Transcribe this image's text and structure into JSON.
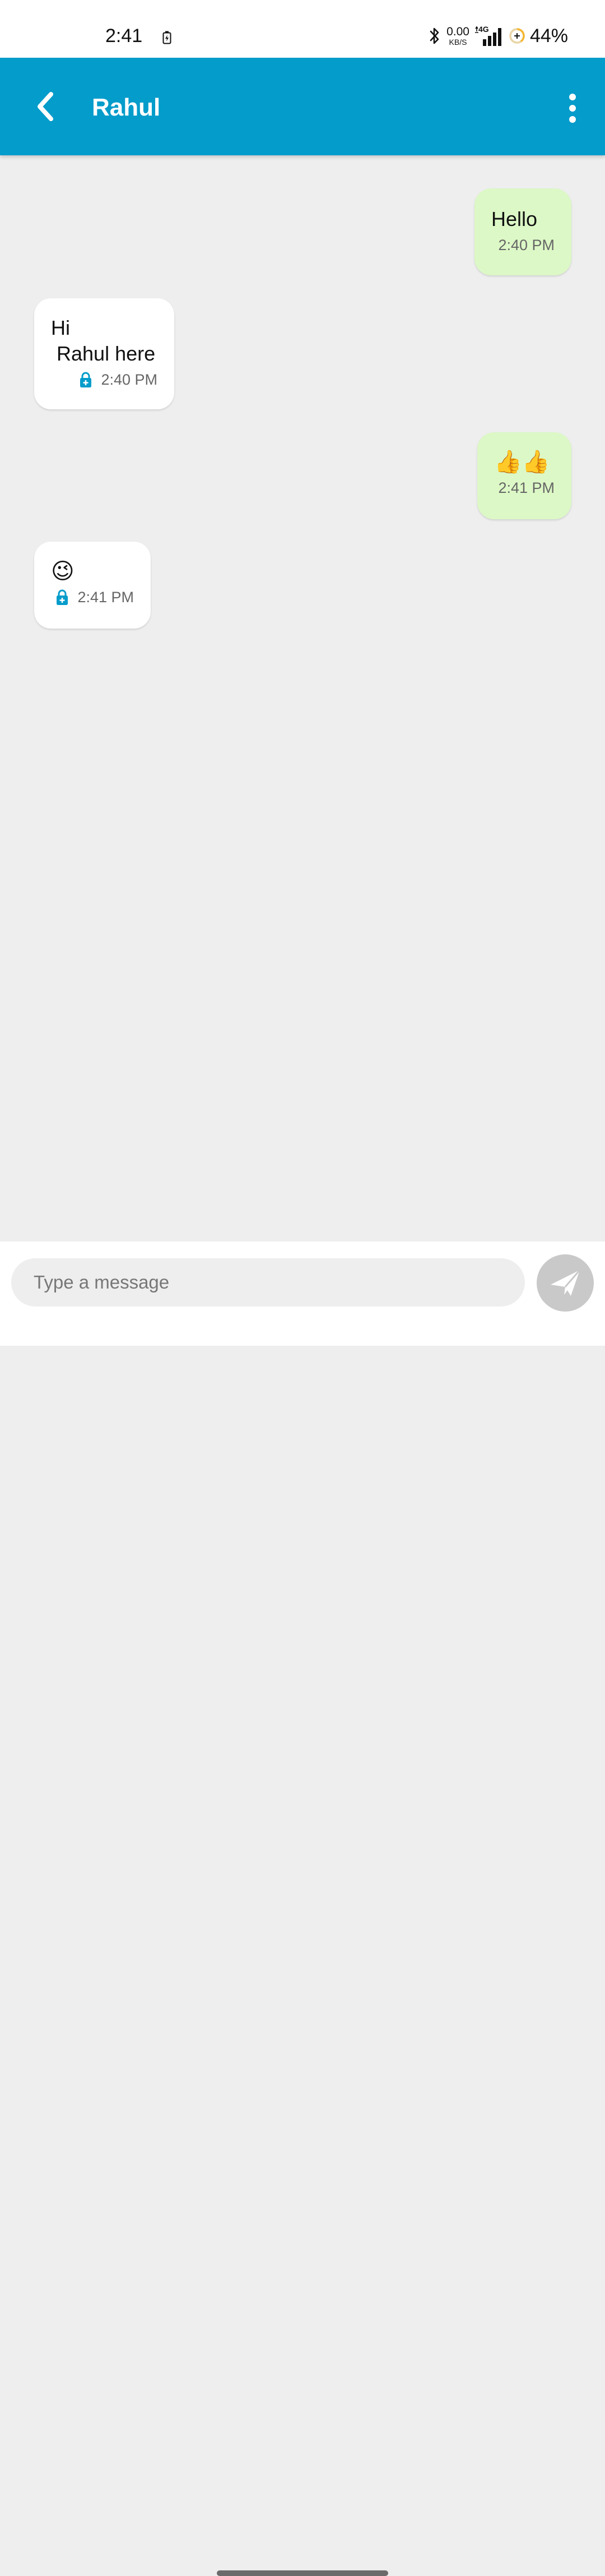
{
  "status_bar": {
    "time": "2:41",
    "net_speed": "0.00",
    "net_speed_unit": "KB/S",
    "network_type": "4G",
    "battery_percent": "44%"
  },
  "header": {
    "contact_name": "Rahul",
    "color": "#039ccb"
  },
  "messages": [
    {
      "direction": "sent",
      "text": "Hello",
      "time": "2:40 PM"
    },
    {
      "direction": "received",
      "text": "Hi\n Rahul here",
      "time": "2:40 PM",
      "icon": "lock-icon"
    },
    {
      "direction": "sent",
      "text": "👍👍",
      "time": "2:41 PM"
    },
    {
      "direction": "received",
      "text": "😉",
      "time": "2:41 PM",
      "icon": "lock-icon"
    }
  ],
  "composer": {
    "placeholder": "Type a message",
    "send_icon": "send-icon"
  },
  "colors": {
    "sent_bubble": "#dcf8c6",
    "received_bubble": "#ffffff",
    "chat_background": "#eeeeee",
    "lock_icon": "#039ccb"
  }
}
